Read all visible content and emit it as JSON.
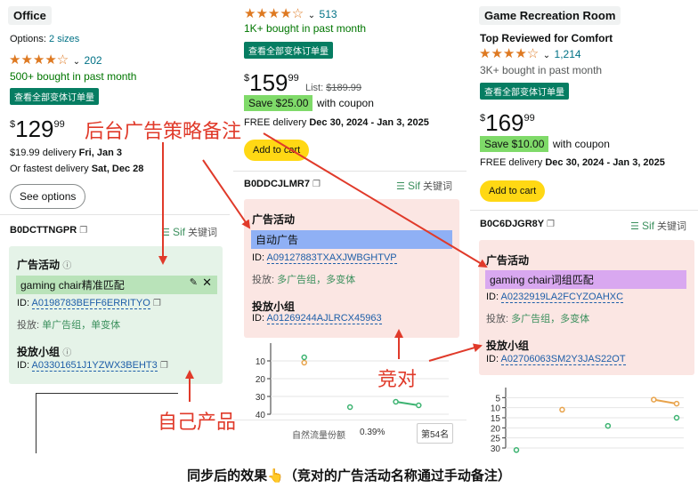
{
  "col1": {
    "tag": "Office",
    "options_label": "Options:",
    "options_value": "2 sizes",
    "stars": "★★★★☆",
    "rating_count": "202",
    "bought": "500+ bought in past month",
    "badge": "查看全部变体订单量",
    "price_cur": "$",
    "price_whole": "129",
    "price_frac": "99",
    "delivery_line1_pre": "$19.99 delivery ",
    "delivery_line1_date": "Fri, Jan 3",
    "delivery_line2_pre": "Or fastest delivery ",
    "delivery_line2_date": "Sat, Dec 28",
    "see_options": "See options",
    "asin": "B0DCTTNGPR",
    "sif": "Sif",
    "sif_kw": "关键词",
    "panel": {
      "ad_activity": "广告活动",
      "campaign": "gaming chair精准匹配",
      "id_label": "ID:",
      "id_value": "A0198783BEFF6ERRITYO",
      "put_label": "投放:",
      "put_value": "单广告组，单变体",
      "group_title": "投放小组",
      "group_id_label": "ID:",
      "group_id_value": "A03301651J1YZWX3BEHT3"
    }
  },
  "col2": {
    "stars": "★★★★☆",
    "rating_count": "513",
    "bought": "1K+ bought in past month",
    "badge": "查看全部变体订单量",
    "price_cur": "$",
    "price_whole": "159",
    "price_frac": "99",
    "list_label": "List:",
    "list_price": "$189.99",
    "coupon": "Save $25.00",
    "coupon_text": "with coupon",
    "delivery_pre": "FREE delivery ",
    "delivery_date": "Dec 30, 2024 - Jan 3, 2025",
    "add_to_cart": "Add to cart",
    "asin": "B0DDCJLMR7",
    "sif": "Sif",
    "sif_kw": "关键词",
    "panel": {
      "ad_activity": "广告活动",
      "campaign": "自动广告",
      "id_label": "ID:",
      "id_value": "A09127883TXAXJWBGHTVP",
      "put_label": "投放:",
      "put_value": "多广告组，多变体",
      "group_title": "投放小组",
      "group_id_label": "ID:",
      "group_id_value": "A01269244AJLRCX45963"
    },
    "chart_footer_label": "自然流量份额",
    "chart_footer_value": "0.39%",
    "chart_footer_rank": "第54名"
  },
  "col3": {
    "tag": "Game Recreation Room",
    "title": "Top Reviewed for Comfort",
    "stars": "★★★★☆",
    "rating_count": "1,214",
    "bought": "3K+ bought in past month",
    "badge": "查看全部变体订单量",
    "price_cur": "$",
    "price_whole": "169",
    "price_frac": "99",
    "coupon": "Save $10.00",
    "coupon_text": "with coupon",
    "delivery_pre": "FREE delivery ",
    "delivery_date": "Dec 30, 2024 - Jan 3, 2025",
    "add_to_cart": "Add to cart",
    "asin": "B0C6DJGR8Y",
    "sif": "Sif",
    "sif_kw": "关键词",
    "panel": {
      "ad_activity": "广告活动",
      "campaign": "gaming chair词组匹配",
      "id_label": "ID:",
      "id_value": "A0232919LA2FCYZOAHXC",
      "put_label": "投放:",
      "put_value": "多广告组，多变体",
      "group_title": "投放小组",
      "group_id_label": "ID:",
      "group_id_value": "A02706063SM2Y3JAS22OT"
    }
  },
  "annotations": {
    "top": "后台广告策略备注",
    "competitor": "竞对",
    "own": "自己产品"
  },
  "caption": "同步后的效果👆（竞对的广告活动名称通过手动备注）",
  "colors": {
    "annotation_red": "#e03a2a",
    "green_panel": "#e5f3e8",
    "red_panel": "#fbe6e3",
    "campaign_green": "#b9e3b9",
    "campaign_blue": "#8fb0f5",
    "campaign_purple": "#d9a8f0",
    "coupon_green": "#7fda69",
    "cart_yellow": "#ffd814"
  },
  "chart_data": [
    {
      "type": "scatter",
      "yticks": [
        "10",
        "20",
        "30",
        "40"
      ],
      "ylim": [
        40,
        0
      ],
      "series": [
        {
          "color": "#e8a34b",
          "points": [
            [
              1,
              11
            ]
          ]
        },
        {
          "color": "#3cb371",
          "points": [
            [
              1,
              8
            ],
            [
              3,
              36
            ],
            [
              5,
              33
            ],
            [
              6,
              35
            ]
          ]
        }
      ]
    },
    {
      "type": "scatter",
      "yticks": [
        "5",
        "10",
        "15",
        "20",
        "25",
        "30"
      ],
      "ylim": [
        30,
        0
      ],
      "series": [
        {
          "color": "#e8a34b",
          "points": [
            [
              2,
              11
            ],
            [
              6,
              6
            ],
            [
              7,
              8
            ]
          ]
        },
        {
          "color": "#3cb371",
          "points": [
            [
              0,
              31
            ],
            [
              4,
              19
            ],
            [
              7,
              15
            ]
          ]
        }
      ]
    }
  ]
}
